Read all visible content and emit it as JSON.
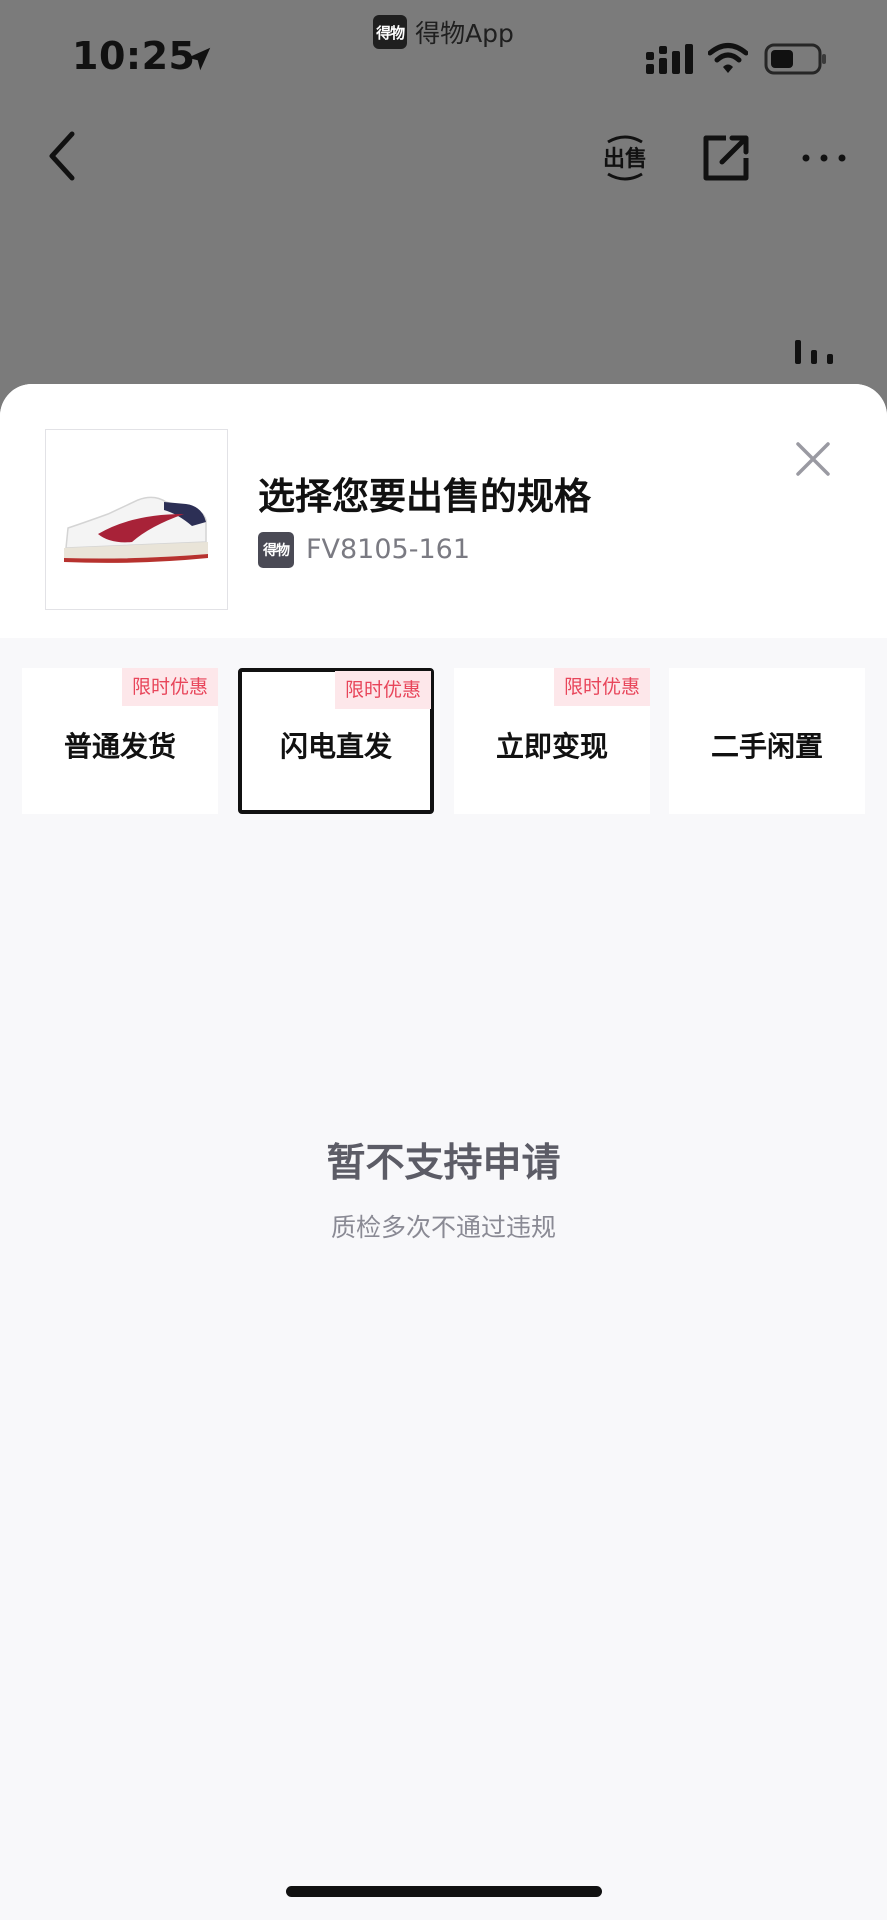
{
  "status_bar": {
    "app_logo_text": "得物",
    "app_name": "得物App",
    "time": "10:25",
    "icons": [
      "location-arrow-icon",
      "signal-icon",
      "wifi-icon",
      "battery-icon"
    ]
  },
  "nav": {
    "icons": [
      "back-chevron-icon",
      "sell-icon",
      "share-icon",
      "more-icon",
      "stats-icon"
    ],
    "sell_icon_text": "出售"
  },
  "sheet": {
    "title": "选择您要出售的规格",
    "brand_badge": "得物",
    "product_code": "FV8105-161",
    "close_icon": "close-icon"
  },
  "tabs": [
    {
      "label": "普通发货",
      "promo": "限时优惠",
      "selected": false
    },
    {
      "label": "闪电直发",
      "promo": "限时优惠",
      "selected": true
    },
    {
      "label": "立即变现",
      "promo": "限时优惠",
      "selected": false
    },
    {
      "label": "二手闲置",
      "promo": "",
      "selected": false
    }
  ],
  "empty_state": {
    "title": "暂不支持申请",
    "subtitle": "质检多次不通过违规"
  },
  "colors": {
    "overlay": "#7b7b7b",
    "sheet_bg": "#f8f8fa",
    "promo_bg": "#fde7ea",
    "promo_text": "#e8455a",
    "text_primary": "#111111"
  }
}
